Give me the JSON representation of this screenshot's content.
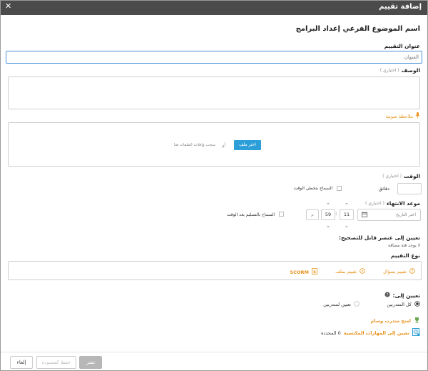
{
  "dialog": {
    "title": "إضافة تقييم",
    "close": "✕",
    "subtopic_heading": "اسم الموضوع الفرعي إعداد البرامج"
  },
  "form": {
    "title_label": "عنوان التقييم",
    "title_placeholder": "العنوان",
    "description_label": "الوصف",
    "optional": "( اختياري )",
    "voice_note": "ملاحظة صوتية",
    "choose_file": "اختر ملف",
    "or": "أو",
    "drag_drop": "سحب وإفلات الملفات هنا",
    "time_label": "الوقت",
    "minutes": "دقائق",
    "allow_exceed_time": "السماح بتخطي الوقت",
    "deadline_label": "موعد الانتهاء",
    "choose_date_placeholder": "اختر التاريخ",
    "hour": "11",
    "minute": "59",
    "ampm": "م",
    "allow_submit_after_time": "السماح بالتسليم بعد الوقت",
    "assign_grading_label": "تعيين إلى عنصر قابل للتصحيح:",
    "no_category": "لا يوجد فئة مضافة",
    "assessment_type_label": "نوع التقييم",
    "types": [
      "تقييم بسؤال",
      "تقييم بملف",
      "SCORM"
    ],
    "assign_to_label": "تعيين إلى:",
    "all_trainees": "كل المتدربين",
    "specific_trainees": "تعيين لمتدربين",
    "award_badge": "امنح متدرب وسام",
    "assign_skills": "تعيين إلى المهارات المكتسبة",
    "selected_count": "0 المحددة"
  },
  "footer": {
    "publish": "نشر",
    "save_draft": "حفظ كمسودة",
    "cancel": "إلغاء"
  },
  "colors": {
    "titlebar": "#4b4b4b",
    "accent_blue": "#2c9fd8",
    "accent_orange": "#e8931c",
    "publish_button": "#b7b7b7"
  }
}
